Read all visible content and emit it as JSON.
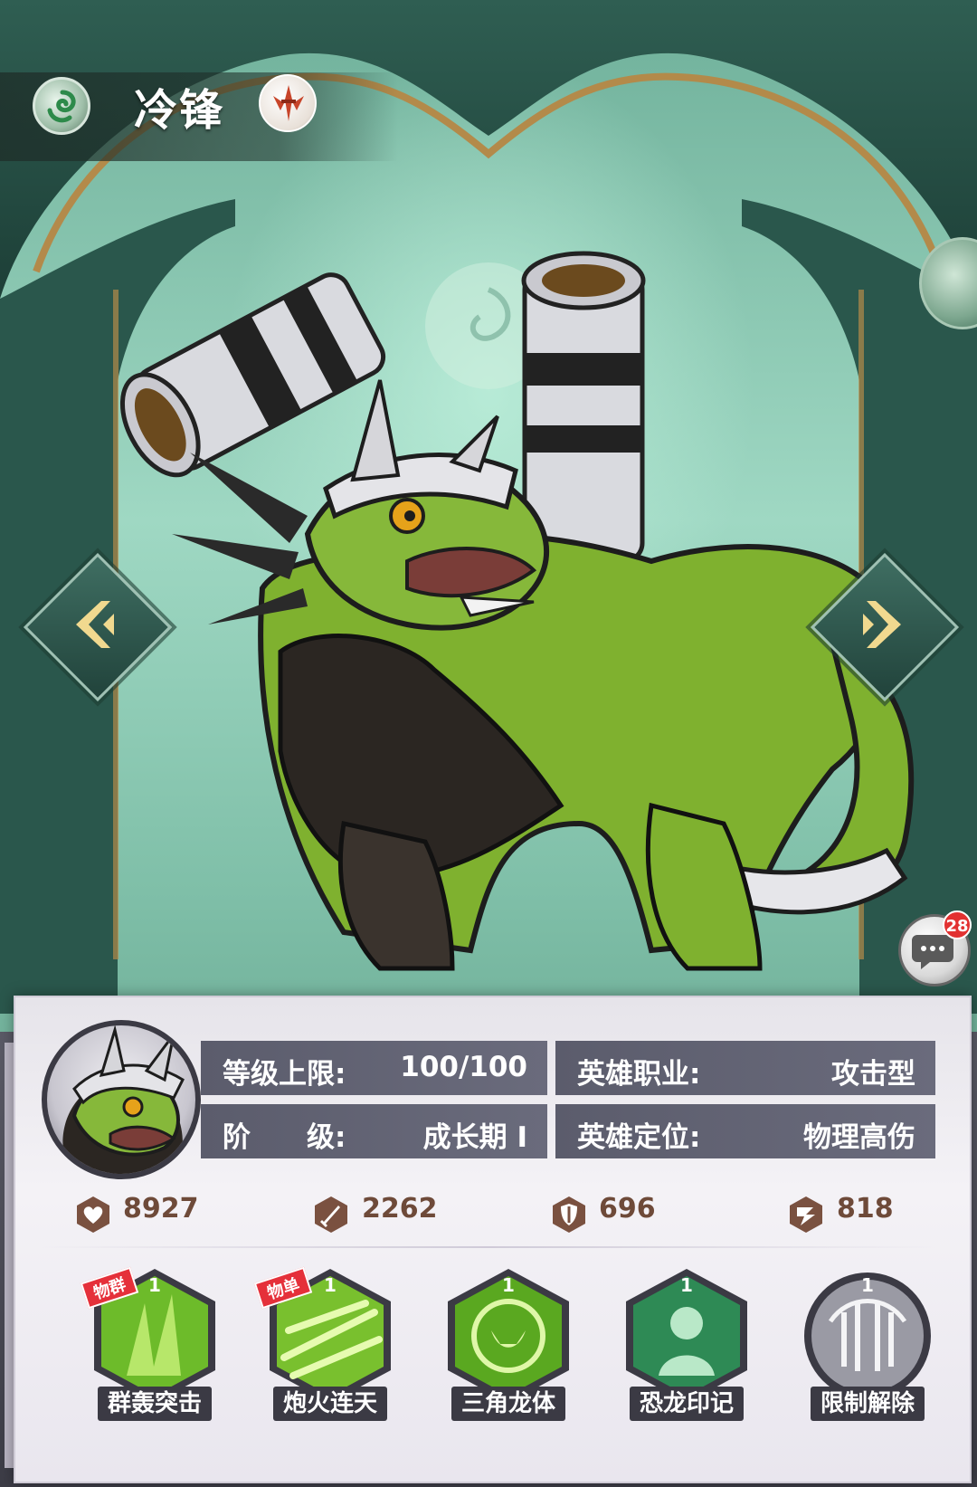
{
  "hero": {
    "name": "冷锋",
    "element_icon": "wind-swirl-icon",
    "faction_icon": "sword-crest-icon"
  },
  "chat": {
    "icon": "chat-bubble-icon",
    "unread_count": "28"
  },
  "info": {
    "level_cap_label": "等级上限:",
    "level_cap_value": "100/100",
    "stage_label": "阶　　级:",
    "stage_value": "成长期 I",
    "role_label": "英雄职业:",
    "role_value": "攻击型",
    "position_label": "英雄定位:",
    "position_value": "物理高伤"
  },
  "stats": [
    {
      "icon": "heart-icon",
      "value": "8927"
    },
    {
      "icon": "sword-icon",
      "value": "2262"
    },
    {
      "icon": "shield-icon",
      "value": "696"
    },
    {
      "icon": "speed-icon",
      "value": "818"
    }
  ],
  "skills": [
    {
      "name": "群轰突击",
      "level": "1",
      "tag": "物群",
      "color": "#6dbb2a"
    },
    {
      "name": "炮火连天",
      "level": "1",
      "tag": "物单",
      "color": "#79c02e"
    },
    {
      "name": "三角龙体",
      "level": "1",
      "tag": "",
      "color": "#5aa820"
    },
    {
      "name": "恐龙印记",
      "level": "1",
      "tag": "",
      "color": "#2e8a55"
    },
    {
      "name": "限制解除",
      "level": "1",
      "tag": "",
      "color": "#9a9aa4"
    }
  ],
  "colors": {
    "accent_green": "#6dbb2a",
    "panel_bar": "#5b5c6c",
    "stat_text": "#6e4a39",
    "badge_red": "#e23131"
  }
}
